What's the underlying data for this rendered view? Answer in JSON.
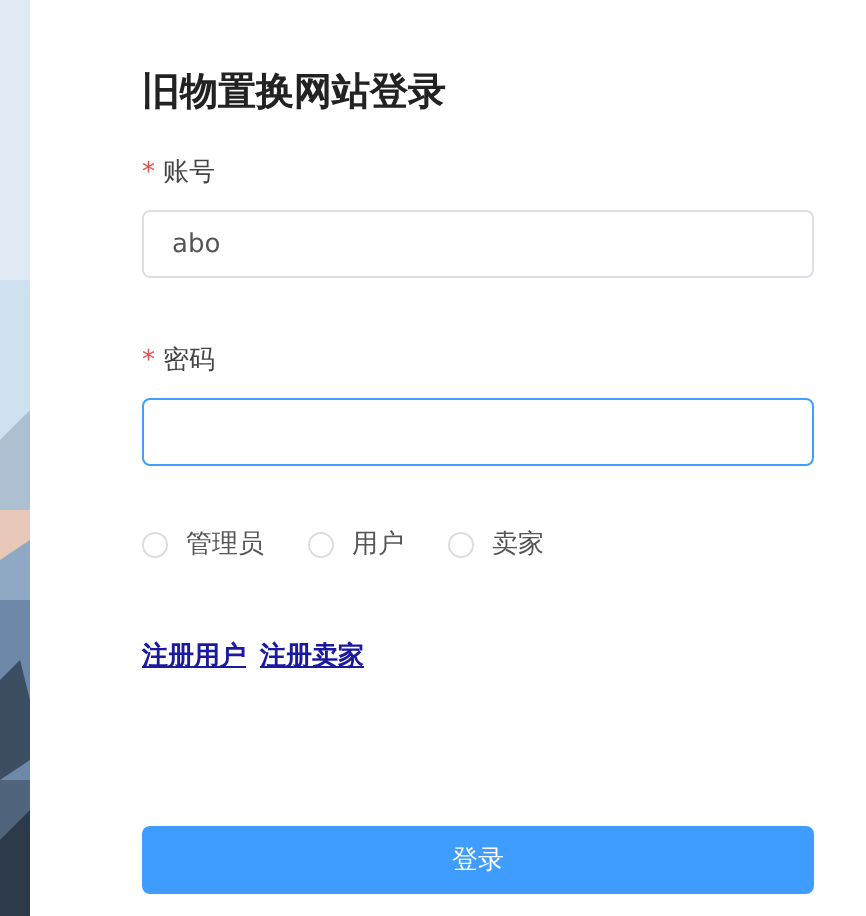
{
  "background": {
    "kind": "picture"
  },
  "title": "旧物置换网站登录",
  "fields": [
    {
      "mark": "*",
      "label": "账号",
      "value": "abo",
      "focused": false,
      "kind": "text"
    },
    {
      "mark": "*",
      "label": "密码",
      "focused": true,
      "kind": "password"
    }
  ],
  "roles": [
    {
      "label": "管理员",
      "selected": false
    },
    {
      "label": "用户",
      "selected": false
    },
    {
      "label": "卖家",
      "selected": false
    }
  ],
  "links": [
    "注册用户",
    "注册卖家"
  ],
  "submit": "登录"
}
